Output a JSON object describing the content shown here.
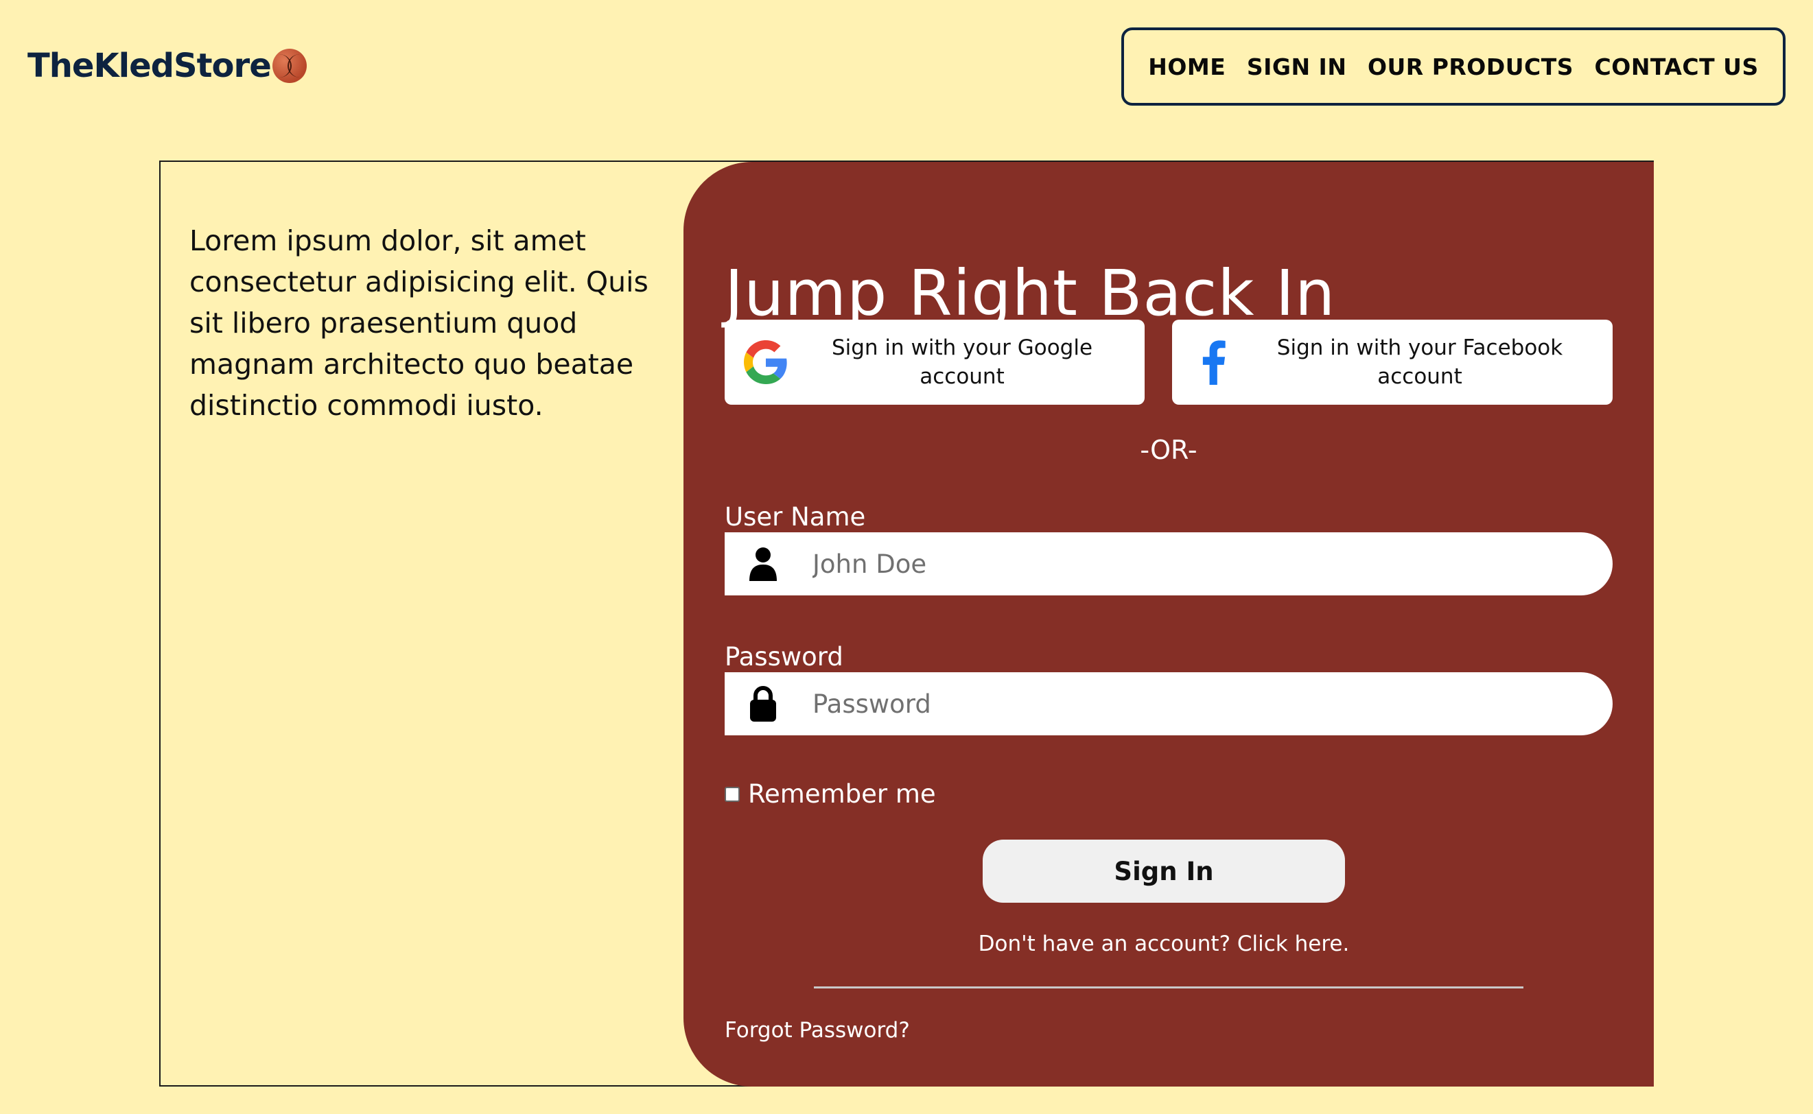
{
  "header": {
    "brand": "TheKledStore",
    "nav": [
      {
        "label": "HOME"
      },
      {
        "label": "SIGN IN"
      },
      {
        "label": "OUR PRODUCTS"
      },
      {
        "label": "CONTACT US"
      }
    ]
  },
  "intro": {
    "text": "Lorem ipsum dolor, sit amet consectetur adipisicing elit. Quis sit libero praesentium quod magnam architecto quo beatae distinctio commodi iusto."
  },
  "login": {
    "title": "Jump Right Back In",
    "google_label": "Sign in with your Google account",
    "facebook_label": "Sign in with your Facebook account",
    "or_text": "-OR-",
    "username_label": "User Name",
    "username_placeholder": "John Doe",
    "password_label": "Password",
    "password_placeholder": "Password",
    "remember_label": "Remember me",
    "submit_label": "Sign In",
    "signup_text": "Don't have an account? Click here.",
    "forgot_text": "Forgot Password?"
  },
  "colors": {
    "background": "#fff2b3",
    "panel": "#852f26",
    "navy": "#0d2340"
  }
}
